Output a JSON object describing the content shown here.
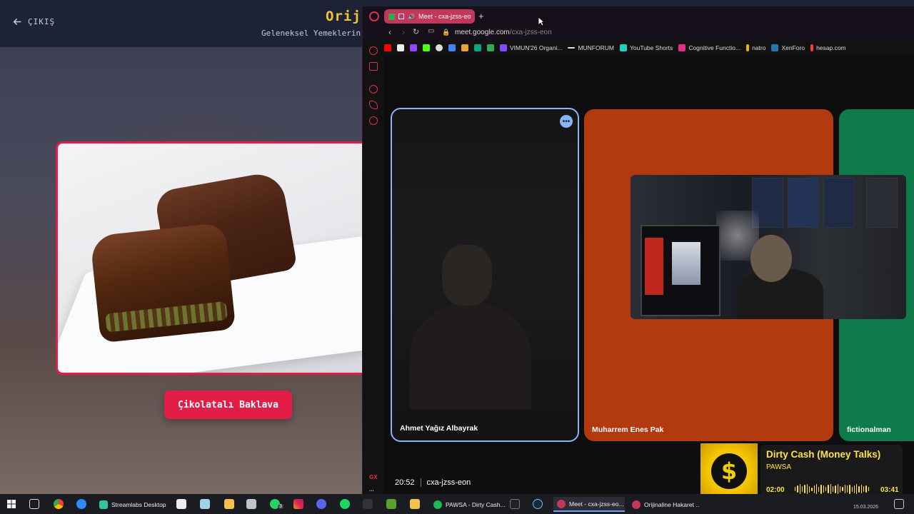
{
  "background_app": {
    "back_label": "ÇIKIŞ",
    "title": "Orij",
    "subtitle": "Geleneksel Yemeklerin",
    "food_name": "Çikolatalı Baklava",
    "accent_color": "#e11d48",
    "title_color": "#f4c430"
  },
  "browser": {
    "tab_title": "Meet - cxa-jzss-eo",
    "new_tab": "+",
    "url_host": "meet.google.com",
    "url_path": "/cxa-jzss-eon",
    "bookmarks": [
      {
        "label": "",
        "icon": "youtube-icon"
      },
      {
        "label": "",
        "icon": "file-icon"
      },
      {
        "label": "",
        "icon": "twitch-icon"
      },
      {
        "label": "",
        "icon": "kick-icon"
      },
      {
        "label": "",
        "icon": "openai-icon"
      },
      {
        "label": "",
        "icon": "translate-icon"
      },
      {
        "label": "",
        "icon": "image-icon"
      },
      {
        "label": "",
        "icon": "chat-icon"
      },
      {
        "label": "",
        "icon": "gpt-icon"
      },
      {
        "label": "VIMUN'26 Organi...",
        "icon": "doc-icon"
      },
      {
        "label": "MUNFORUM",
        "icon": "dash-icon"
      },
      {
        "label": "YouTube Shorts",
        "icon": "shorts-icon"
      },
      {
        "label": "Cognitive Functio...",
        "icon": "brain-icon"
      },
      {
        "label": "natro",
        "icon": "natro-icon"
      },
      {
        "label": "XenForo",
        "icon": "xenforo-icon"
      },
      {
        "label": "hesap.com",
        "icon": "hesap-icon"
      }
    ],
    "sidebar_gx": "GX",
    "sidebar_more": "..."
  },
  "meet": {
    "participants": [
      {
        "name": "Ahmet Yağız Albayrak",
        "color": "#151518"
      },
      {
        "name": "Muharrem Enes Pak",
        "color": "#b3390f"
      },
      {
        "name": "fictionalman",
        "color": "#0f7a4a"
      }
    ],
    "time": "20:52",
    "meeting_code": "cxa-jzss-eon",
    "menu_glyph": "•••"
  },
  "music": {
    "title": "Dirty Cash (Money Talks)",
    "artist": "PAWSA",
    "elapsed": "02:00",
    "total": "03:41",
    "art_symbol": "$",
    "accent": "#ffe24a"
  },
  "taskbar": {
    "apps": [
      {
        "label": "Streamlabs Desktop",
        "color": "#31c3a2",
        "active": false
      },
      {
        "label": "PAWSA - Dirty Cash...",
        "color": "#1db954",
        "active": false
      },
      {
        "label": "Meet - cxa-jzss-eo...",
        "color": "#c2375a",
        "active": true
      },
      {
        "label": "Orijinaline Hakaret ...",
        "color": "#c2375a",
        "active": false
      }
    ],
    "clock_badge": "3",
    "date": "15.03.2026"
  }
}
